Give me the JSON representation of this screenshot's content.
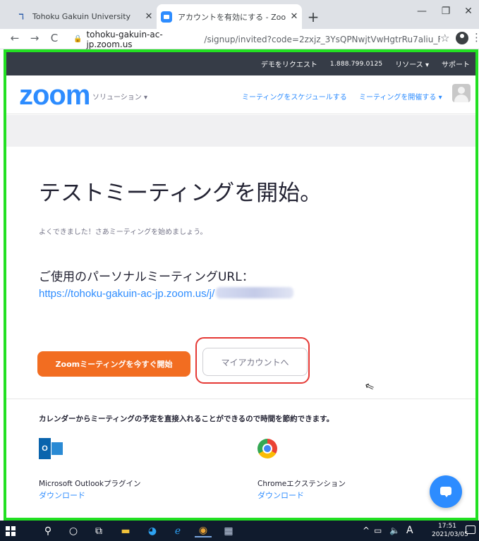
{
  "browser": {
    "tabs": [
      {
        "title": "Tohoku Gakuin University",
        "active": false
      },
      {
        "title": "アカウントを有効にする - Zoom",
        "active": true
      }
    ],
    "new_tab": "+",
    "url_host": "tohoku-gakuin-ac-jp.zoom.us",
    "url_rest": "/signup/invited?code=2zxjz_3YsQPNwjtVwHgtrRu7aliu_F..."
  },
  "zoom_topbar": {
    "request_demo": "デモをリクエスト",
    "phone": "1.888.799.0125",
    "resources": "リソース ▾",
    "support": "サポート"
  },
  "zoom_header": {
    "logo": "zoom",
    "solutions": "ソリューション ▾",
    "schedule": "ミーティングをスケジュールする",
    "host": "ミーティングを開催する ▾"
  },
  "main": {
    "heading": "テストミーティングを開始。",
    "subtext": "よくできました！さあミーティングを始めましょう。",
    "pm_url_label": "ご使用のパーソナルミーティングURL：",
    "pm_url": "https://tohoku-gakuin-ac-jp.zoom.us/j/",
    "start_button": "Zoomミーティングを今すぐ開始",
    "my_account_button": "マイアカウントへ",
    "promo": "カレンダーからミーティングの予定を直接入れることができるので時間を節約できます。",
    "plugins": [
      {
        "name": "Microsoft Outlookプラグイン",
        "link": "ダウンロード"
      },
      {
        "name": "Chromeエクステンション",
        "link": "ダウンロード"
      }
    ]
  },
  "taskbar": {
    "ime": "A",
    "time": "17:51",
    "date": "2021/03/05"
  },
  "colors": {
    "zoom_blue": "#2d8cff",
    "zoom_orange": "#f26d21",
    "highlight_red": "#e53935",
    "frame_green": "#22e022"
  }
}
